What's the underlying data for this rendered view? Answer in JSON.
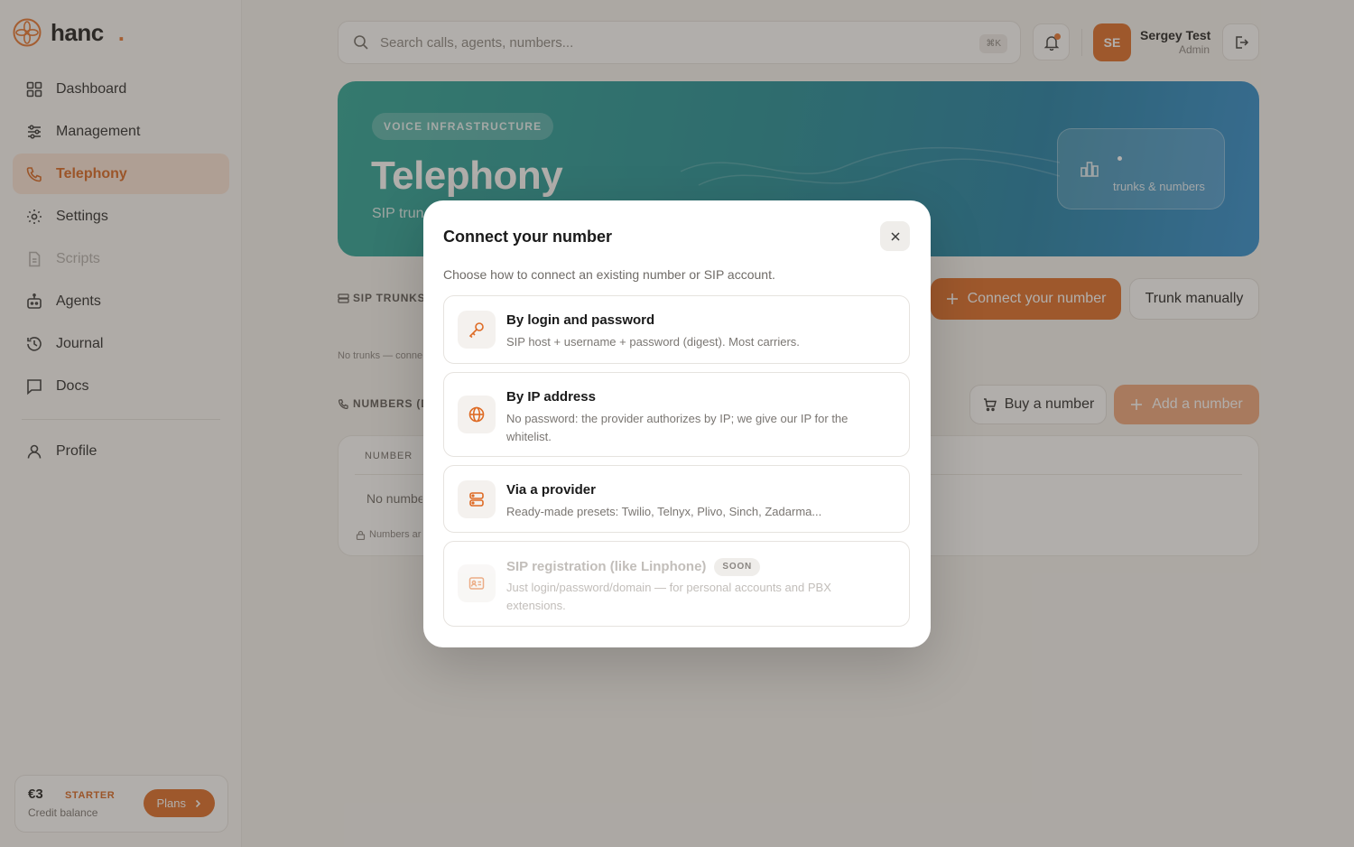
{
  "app": {
    "name": "hanc",
    "dot": "."
  },
  "sidebar": {
    "items": [
      {
        "label": "Dashboard",
        "icon": "grid-icon"
      },
      {
        "label": "Management",
        "icon": "sliders-icon"
      },
      {
        "label": "Telephony",
        "icon": "phone-icon",
        "active": true
      },
      {
        "label": "Settings",
        "icon": "gear-icon"
      },
      {
        "label": "Scripts",
        "icon": "document-icon",
        "disabled": true
      },
      {
        "label": "Agents",
        "icon": "robot-icon"
      },
      {
        "label": "Journal",
        "icon": "history-icon"
      },
      {
        "label": "Docs",
        "icon": "chat-icon"
      },
      {
        "label": "Profile",
        "icon": "user-icon"
      }
    ],
    "credit": {
      "amount": "€3",
      "tier": "STARTER",
      "label": "Credit balance",
      "plans_label": "Plans"
    }
  },
  "header": {
    "search_placeholder": "Search calls, agents, numbers...",
    "shortcut": "⌘K",
    "user": {
      "initials": "SE",
      "name": "Sergey Test",
      "role": "Admin"
    }
  },
  "hero": {
    "badge": "VOICE INFRASTRUCTURE",
    "title": "Telephony",
    "subtitle": "SIP trun",
    "card_label": "trunks & numbers"
  },
  "sip_trunks": {
    "label": "SIP TRUNKS",
    "empty": "No trunks — conne",
    "connect_label": "Connect your number",
    "manual_label": "Trunk manually"
  },
  "numbers": {
    "label": "NUMBERS (DI",
    "buy_label": "Buy a number",
    "add_label": "Add a number",
    "column": "NUMBER",
    "empty": "No numbe",
    "note": "Numbers ar"
  },
  "modal": {
    "title": "Connect your number",
    "description": "Choose how to connect an existing number or SIP account.",
    "options": [
      {
        "title": "By login and password",
        "desc": "SIP host + username + password (digest). Most carriers.",
        "icon": "key-icon"
      },
      {
        "title": "By IP address",
        "desc": "No password: the provider authorizes by IP; we give our IP for the whitelist.",
        "icon": "globe-icon"
      },
      {
        "title": "Via a provider",
        "desc": "Ready-made presets: Twilio, Telnyx, Plivo, Sinch, Zadarma...",
        "icon": "server-icon"
      },
      {
        "title": "SIP registration (like Linphone)",
        "badge": "SOON",
        "desc": "Just login/password/domain — for personal accounts and PBX extensions.",
        "icon": "id-card-icon",
        "disabled": true
      }
    ]
  },
  "colors": {
    "accent": "#de6b25",
    "hero_start": "#2aa596",
    "hero_end": "#2f8ed0"
  }
}
